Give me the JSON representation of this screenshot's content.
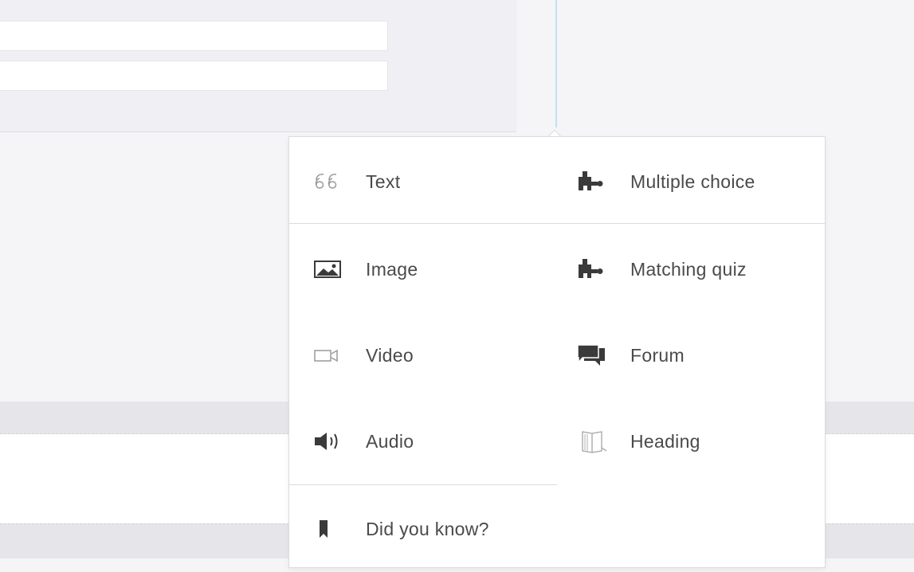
{
  "menu": {
    "items": [
      {
        "id": "text",
        "label": "Text",
        "icon": "quote-icon"
      },
      {
        "id": "multiple-choice",
        "label": "Multiple choice",
        "icon": "puzzle-icon"
      },
      {
        "id": "image",
        "label": "Image",
        "icon": "image-icon"
      },
      {
        "id": "matching-quiz",
        "label": "Matching quiz",
        "icon": "puzzle-icon"
      },
      {
        "id": "video",
        "label": "Video",
        "icon": "video-camera-icon"
      },
      {
        "id": "forum",
        "label": "Forum",
        "icon": "chat-bubbles-icon"
      },
      {
        "id": "audio",
        "label": "Audio",
        "icon": "speaker-icon"
      },
      {
        "id": "heading",
        "label": "Heading",
        "icon": "book-icon"
      },
      {
        "id": "did-you-know",
        "label": "Did you know?",
        "icon": "bookmark-icon"
      }
    ]
  },
  "colors": {
    "accent_line": "#bde3f3",
    "icon_dark": "#3a3a3a",
    "icon_light": "#9a9a9a",
    "text": "#4a4a4a"
  }
}
